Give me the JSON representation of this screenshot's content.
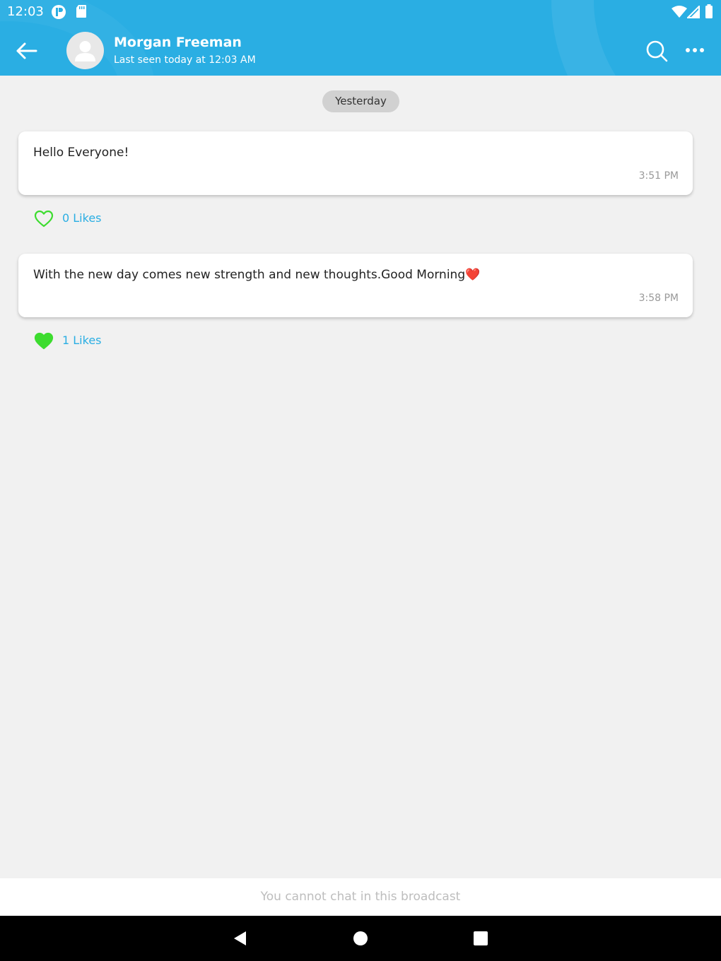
{
  "status_bar": {
    "time": "12:03",
    "icons": [
      "app-notification-icon",
      "sd-card-icon",
      "wifi-icon",
      "signal-icon",
      "battery-icon"
    ]
  },
  "header": {
    "contact_name": "Morgan Freeman",
    "last_seen": "Last seen today at 12:03 AM",
    "icons": [
      "back-arrow-icon",
      "avatar-icon",
      "search-icon",
      "more-icon"
    ],
    "color": "#2aaee3"
  },
  "date_separator": "Yesterday",
  "messages": [
    {
      "text": "Hello Everyone!",
      "time": "3:51 PM",
      "likes_label": "0 Likes",
      "liked": false
    },
    {
      "text": "With the new day comes new strength and new thoughts.Good Morning❤️",
      "time": "3:58 PM",
      "likes_label": "1 Likes",
      "liked": true
    }
  ],
  "footer": {
    "notice": "You cannot chat in this broadcast"
  },
  "nav_bar": {
    "icons": [
      "nav-back-icon",
      "nav-home-icon",
      "nav-recents-icon"
    ]
  },
  "colors": {
    "accent": "#2aaee3",
    "like": "#3ddc2f",
    "background": "#f1f1f1"
  }
}
